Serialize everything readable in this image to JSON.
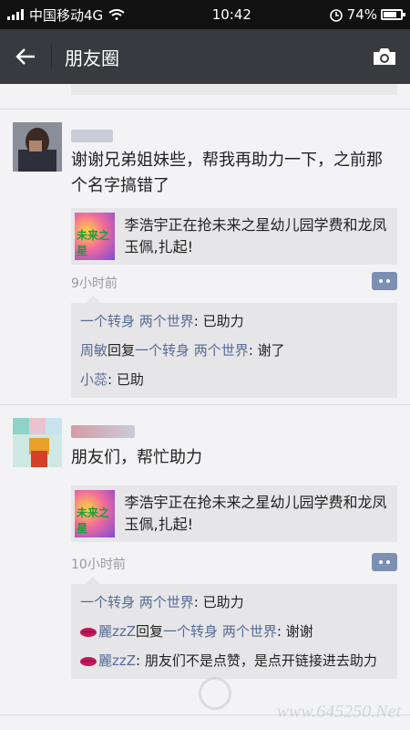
{
  "status_bar": {
    "carrier": "中国移动4G",
    "time": "10:42",
    "battery": "74%"
  },
  "header": {
    "title": "朋友圈"
  },
  "posts": [
    {
      "text": "谢谢兄弟姐妹些，帮我再助力一下，之前那个名字搞错了",
      "link_title": "李浩宇正在抢未来之星幼儿园学费和龙凤玉佩,扎起!",
      "thumb_text": "未来之星",
      "time": "9小时前",
      "comments": [
        {
          "name": "一个转身 两个世界",
          "sep": ": ",
          "text": "已助力"
        },
        {
          "name": "周敏",
          "reply": "回复",
          "target": "一个转身 两个世界",
          "sep": ": ",
          "text": "谢了"
        },
        {
          "name": "小蕊",
          "sep": ": ",
          "text": "已助"
        }
      ]
    },
    {
      "text": "朋友们，帮忙助力",
      "link_title": "李浩宇正在抢未来之星幼儿园学费和龙凤玉佩,扎起!",
      "thumb_text": "未来之星",
      "time": "10小时前",
      "comments": [
        {
          "name": "一个转身 两个世界",
          "sep": ": ",
          "text": "已助力"
        },
        {
          "name": "麗zzZ",
          "reply": "回复",
          "target": "一个转身 两个世界",
          "sep": ": ",
          "text": "谢谢"
        },
        {
          "name": "麗zzZ",
          "sep": ": ",
          "text": "朋友们不是点赞，是点开链接进去助力"
        }
      ]
    }
  ],
  "watermark": "www.645250.Net",
  "colors": {
    "status_bar": "#111111",
    "title_bar": "#393a3f",
    "name_link": "#576b95",
    "background": "#f3f3f5",
    "card": "#e6e6e8"
  },
  "icons": [
    "signal-icon",
    "wifi-icon",
    "alarm-icon",
    "battery-icon",
    "back-arrow-icon",
    "camera-icon",
    "more-icon",
    "lips-emoji-icon"
  ]
}
